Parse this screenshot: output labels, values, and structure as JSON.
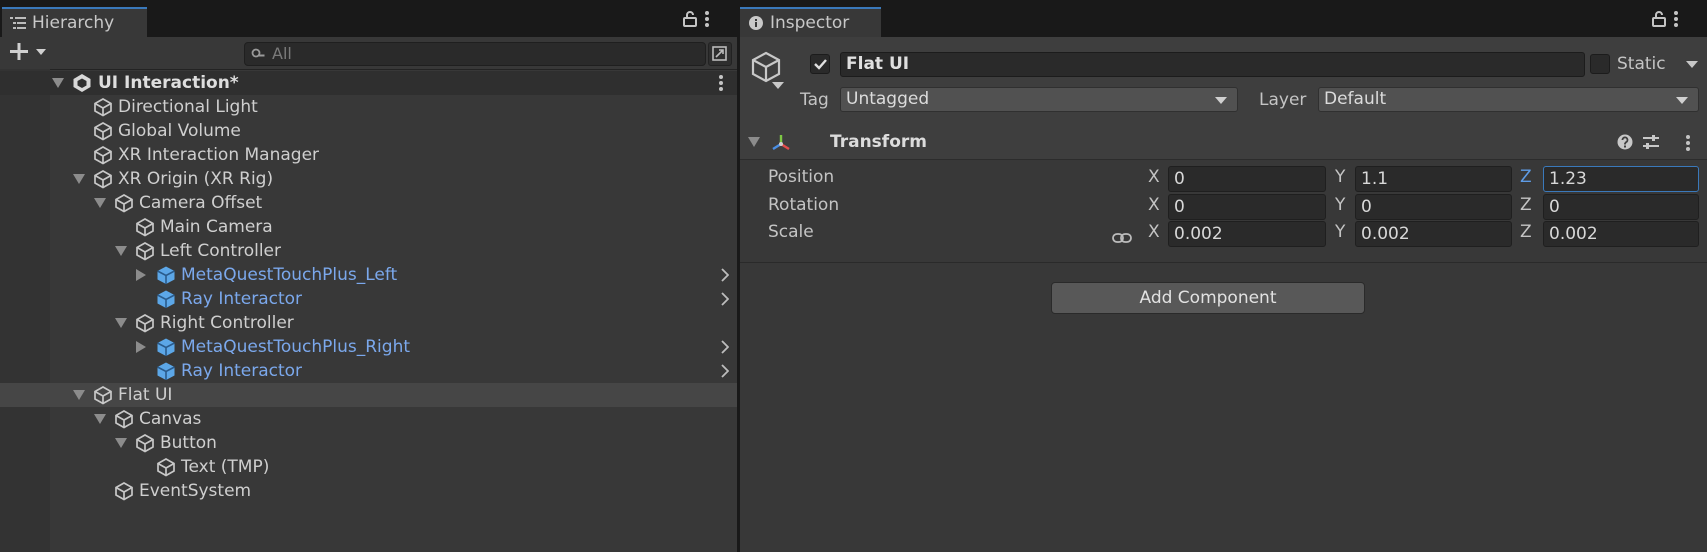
{
  "hierarchy": {
    "tab_label": "Hierarchy",
    "search_placeholder": "All",
    "rows": [
      {
        "label": "UI Interaction*",
        "style": "scene",
        "expand": "down",
        "icon": "unity-scene-icon",
        "indent": 0
      },
      {
        "label": "Directional Light",
        "style": "normal",
        "expand": "none",
        "icon": "gameobject-icon",
        "indent": 1
      },
      {
        "label": "Global Volume",
        "style": "normal",
        "expand": "none",
        "icon": "gameobject-icon",
        "indent": 1
      },
      {
        "label": "XR Interaction Manager",
        "style": "normal",
        "expand": "none",
        "icon": "gameobject-icon",
        "indent": 1
      },
      {
        "label": "XR Origin (XR Rig)",
        "style": "normal",
        "expand": "down",
        "icon": "gameobject-icon",
        "indent": 1
      },
      {
        "label": "Camera Offset",
        "style": "normal",
        "expand": "down",
        "icon": "gameobject-icon",
        "indent": 2
      },
      {
        "label": "Main Camera",
        "style": "normal",
        "expand": "none",
        "icon": "gameobject-icon",
        "indent": 3
      },
      {
        "label": "Left Controller",
        "style": "normal",
        "expand": "down",
        "icon": "gameobject-icon",
        "indent": 3
      },
      {
        "label": "MetaQuestTouchPlus_Left",
        "style": "prefab",
        "expand": "right",
        "icon": "prefab-icon",
        "indent": 4
      },
      {
        "label": "Ray Interactor",
        "style": "prefab",
        "expand": "none",
        "icon": "prefab-icon",
        "indent": 4
      },
      {
        "label": "Right Controller",
        "style": "normal",
        "expand": "down",
        "icon": "gameobject-icon",
        "indent": 3
      },
      {
        "label": "MetaQuestTouchPlus_Right",
        "style": "prefab",
        "expand": "right",
        "icon": "prefab-icon",
        "indent": 4
      },
      {
        "label": "Ray Interactor",
        "style": "prefab",
        "expand": "none",
        "icon": "prefab-icon",
        "indent": 4
      },
      {
        "label": "Flat UI",
        "style": "selected",
        "expand": "down",
        "icon": "gameobject-icon",
        "indent": 1
      },
      {
        "label": "Canvas",
        "style": "normal",
        "expand": "down",
        "icon": "gameobject-icon",
        "indent": 2
      },
      {
        "label": "Button",
        "style": "normal",
        "expand": "down",
        "icon": "gameobject-icon",
        "indent": 3
      },
      {
        "label": "Text (TMP)",
        "style": "normal",
        "expand": "none",
        "icon": "gameobject-icon",
        "indent": 4
      },
      {
        "label": "EventSystem",
        "style": "normal",
        "expand": "none",
        "icon": "gameobject-icon",
        "indent": 2
      }
    ]
  },
  "inspector": {
    "tab_label": "Inspector",
    "object_name": "Flat UI",
    "active_checked": true,
    "static_label": "Static",
    "static_checked": false,
    "tag_label": "Tag",
    "tag_value": "Untagged",
    "layer_label": "Layer",
    "layer_value": "Default",
    "transform": {
      "title": "Transform",
      "rows": [
        {
          "label": "Position",
          "x": "0",
          "y": "1.1",
          "z": "1.23"
        },
        {
          "label": "Rotation",
          "x": "0",
          "y": "0",
          "z": "0"
        },
        {
          "label": "Scale",
          "x": "0.002",
          "y": "0.002",
          "z": "0.002"
        }
      ],
      "axis_labels": {
        "x": "X",
        "y": "Y",
        "z": "Z"
      }
    },
    "add_component_label": "Add Component"
  },
  "colors": {
    "accent": "#3a79bb",
    "prefab_text": "#7ba8ec",
    "panel_bg": "#383838"
  }
}
